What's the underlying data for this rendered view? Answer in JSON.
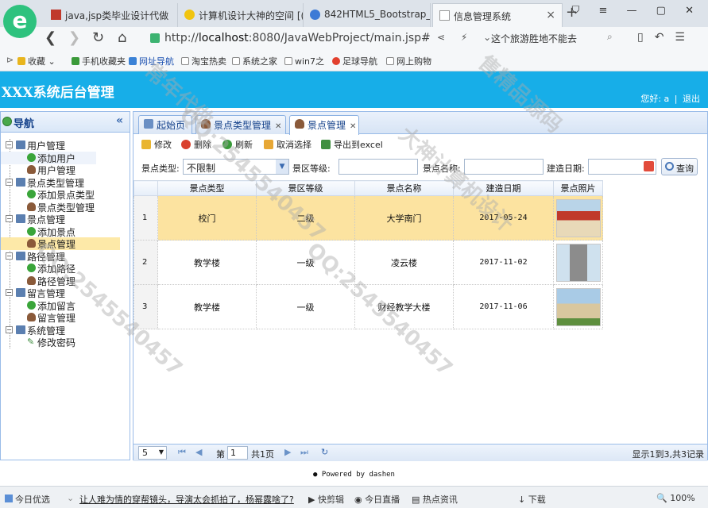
{
  "browser": {
    "tabs": [
      {
        "title": "java,jsp类毕业设计代做"
      },
      {
        "title": "计算机设计大神的空间 [("
      },
      {
        "title": "842HTML5_Bootstrap_"
      },
      {
        "title": "信息管理系统"
      }
    ],
    "url_prefix": "http://",
    "url_host": "localhost",
    "url_rest": ":8080/JavaWebProject/main.jsp#",
    "search_text": "这个旅游胜地不能去",
    "bookmarks": [
      "收藏",
      "手机收藏夹",
      "网址导航",
      "淘宝热卖",
      "系统之家",
      "win7之",
      "足球导航",
      "网上购物"
    ]
  },
  "header": {
    "title": "XXX系统后台管理",
    "greeting": "您好: a",
    "logout": "退出"
  },
  "sidebar": {
    "title": "导航",
    "groups": [
      {
        "label": "用户管理",
        "items": [
          "添加用户",
          "用户管理"
        ]
      },
      {
        "label": "景点类型管理",
        "items": [
          "添加景点类型",
          "景点类型管理"
        ]
      },
      {
        "label": "景点管理",
        "items": [
          "添加景点",
          "景点管理"
        ]
      },
      {
        "label": "路径管理",
        "items": [
          "添加路径",
          "路径管理"
        ]
      },
      {
        "label": "留言管理",
        "items": [
          "添加留言",
          "留言管理"
        ]
      },
      {
        "label": "系统管理",
        "items": [
          "修改密码"
        ]
      }
    ]
  },
  "tabs": [
    "起始页",
    "景点类型管理",
    "景点管理"
  ],
  "toolbar": {
    "edit": "修改",
    "delete": "删除",
    "refresh": "刷新",
    "cancel": "取消选择",
    "export": "导出到excel"
  },
  "filters": {
    "type_label": "景点类型:",
    "type_value": "不限制",
    "level_label": "景区等级:",
    "name_label": "景点名称:",
    "date_label": "建造日期:",
    "query": "查询"
  },
  "grid": {
    "columns": [
      "景点类型",
      "景区等级",
      "景点名称",
      "建造日期",
      "景点照片"
    ],
    "rows": [
      {
        "n": "1",
        "type": "校门",
        "level": "二级",
        "name": "大学南门",
        "date": "2017-05-24"
      },
      {
        "n": "2",
        "type": "教学楼",
        "level": "一级",
        "name": "凌云楼",
        "date": "2017-11-02"
      },
      {
        "n": "3",
        "type": "教学楼",
        "level": "一级",
        "name": "财经教学大楼",
        "date": "2017-11-06"
      }
    ]
  },
  "pager": {
    "page_size": "5",
    "page_label_before": "第",
    "page_value": "1",
    "page_label_after": "共1页",
    "summary": "显示1到3,共3记录"
  },
  "footer": "Powered by dashen",
  "statusbar": {
    "left": "今日优选",
    "news": "让人难为情的穿帮镜头，导演太会抓拍了，杨幂露啥了?",
    "quickclip": "快剪辑",
    "live": "今日直播",
    "hot": "热点资讯",
    "download": "下载",
    "zoom": "100%"
  },
  "watermark": {
    "text1": "QQ:2545540457",
    "text2": "大神计算机设计",
    "text3": "常年代做",
    "text4": "售精品源码"
  },
  "colors": {
    "header_bg": "#17aee8",
    "selected_row": "#fce3a0",
    "panel_border": "#99bbe8"
  }
}
